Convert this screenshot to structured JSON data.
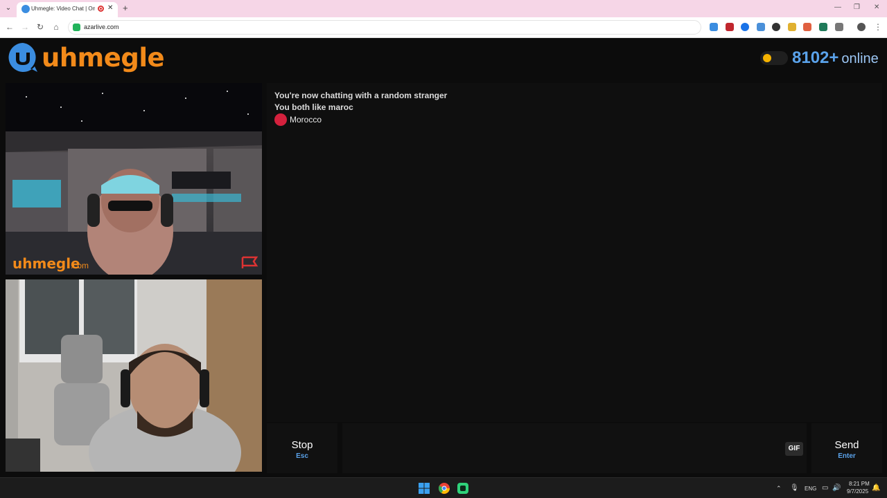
{
  "browser": {
    "tab_title": "Uhmegle: Video Chat | Ome",
    "url": "azarlive.com",
    "new_tab": "+",
    "close_tab": "✕"
  },
  "header": {
    "logo_text": "uhmegle",
    "online_count": "8102+",
    "online_label": "online"
  },
  "stranger_video": {
    "watermark": "uhmegle",
    "watermark_suffix": ".com"
  },
  "chat": {
    "lines": [
      "You're now chatting with a random stranger",
      "You both like maroc"
    ],
    "country": "Morocco"
  },
  "controls": {
    "stop_label": "Stop",
    "stop_hint": "Esc",
    "send_label": "Send",
    "send_hint": "Enter",
    "gif_label": "GIF",
    "message_placeholder": ""
  },
  "taskbar": {
    "language": "ENG",
    "time": "8:21 PM",
    "date": "9/7/2025"
  },
  "colors": {
    "brand_orange": "#f28a1a",
    "brand_blue": "#3b8de0",
    "online_blue": "#5aa2ea",
    "flag_red": "#d4213d"
  }
}
